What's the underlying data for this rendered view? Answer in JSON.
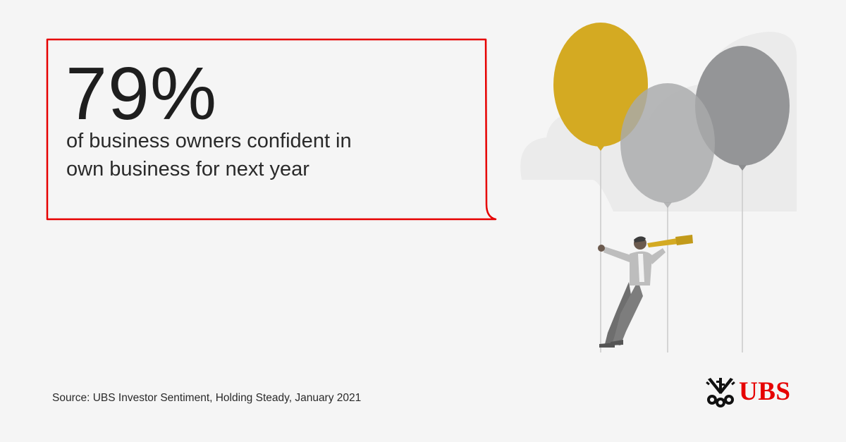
{
  "headline": {
    "value": "79%",
    "caption_line1": "of business owners confident in",
    "caption_line2": "own business for next year"
  },
  "source": "Source: UBS Investor Sentiment, Holding Steady, January 2021",
  "brand": {
    "wordmark": "UBS"
  },
  "colors": {
    "frame_red": "#e60000",
    "gold": "#d4aa22",
    "light_gray": "#b4b4b4",
    "dark_gray": "#8c8c8c",
    "background": "#f5f5f5"
  },
  "illustration": {
    "subject": "person holding balloons looking through telescope",
    "icons": [
      "balloon-gold",
      "balloon-light-gray",
      "balloon-dark-gray",
      "cloud",
      "telescope"
    ]
  }
}
